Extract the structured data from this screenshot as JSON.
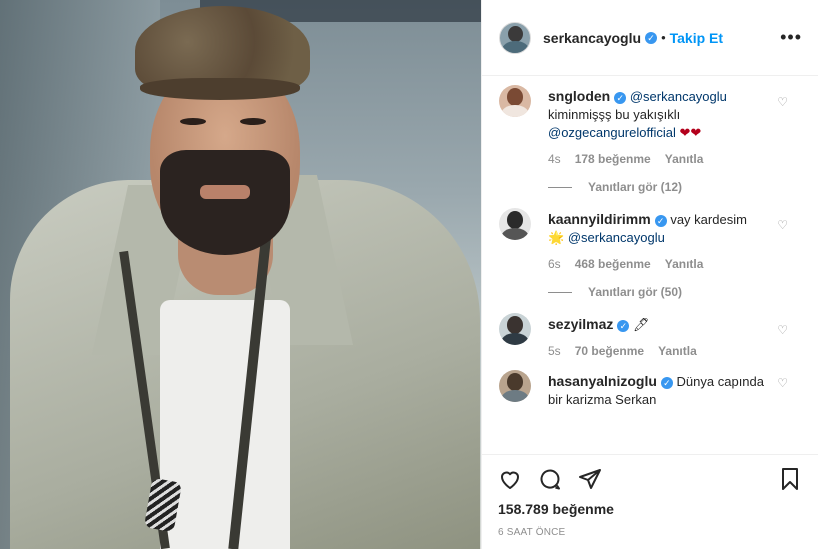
{
  "post": {
    "author": "serkancayoglu",
    "separator": "•",
    "follow_label": "Takip Et",
    "more_label": "•••"
  },
  "comments": [
    {
      "username": "sngloden",
      "mention1": "@serkancayoglu",
      "text": "kiminmişşş bu yakışıklı",
      "mention2": "@ozgecangurelofficial",
      "emoji": "❤❤",
      "emoji_color": "#b3001b",
      "time": "4s",
      "likes": "178 beğenme",
      "reply": "Yanıtla",
      "view_replies": "Yanıtları gör (12)"
    },
    {
      "username": "kaannyildirimm",
      "text": "vay kardesim",
      "emoji": "🌟",
      "mention1": "@serkancayoglu",
      "time": "6s",
      "likes": "468 beğenme",
      "reply": "Yanıtla",
      "view_replies": "Yanıtları gör (50)"
    },
    {
      "username": "sezyilmaz",
      "emoji": "🖊",
      "time": "5s",
      "likes": "70 beğenme",
      "reply": "Yanıtla"
    },
    {
      "username": "hasanyalnizoglu",
      "text": "Dünya capında bir karizma Serkan"
    }
  ],
  "footer": {
    "likes_count": "158.789 beğenme",
    "time_ago": "6 SAAT ÖNCE"
  },
  "icons": {
    "heart": "heart-icon",
    "comment": "comment-icon",
    "share": "share-icon",
    "bookmark": "bookmark-icon",
    "verified": "verified-badge-icon"
  },
  "colors": {
    "accent": "#0095f6",
    "verified": "#3897f0",
    "mention": "#00376b",
    "muted": "#8e8e8e"
  }
}
